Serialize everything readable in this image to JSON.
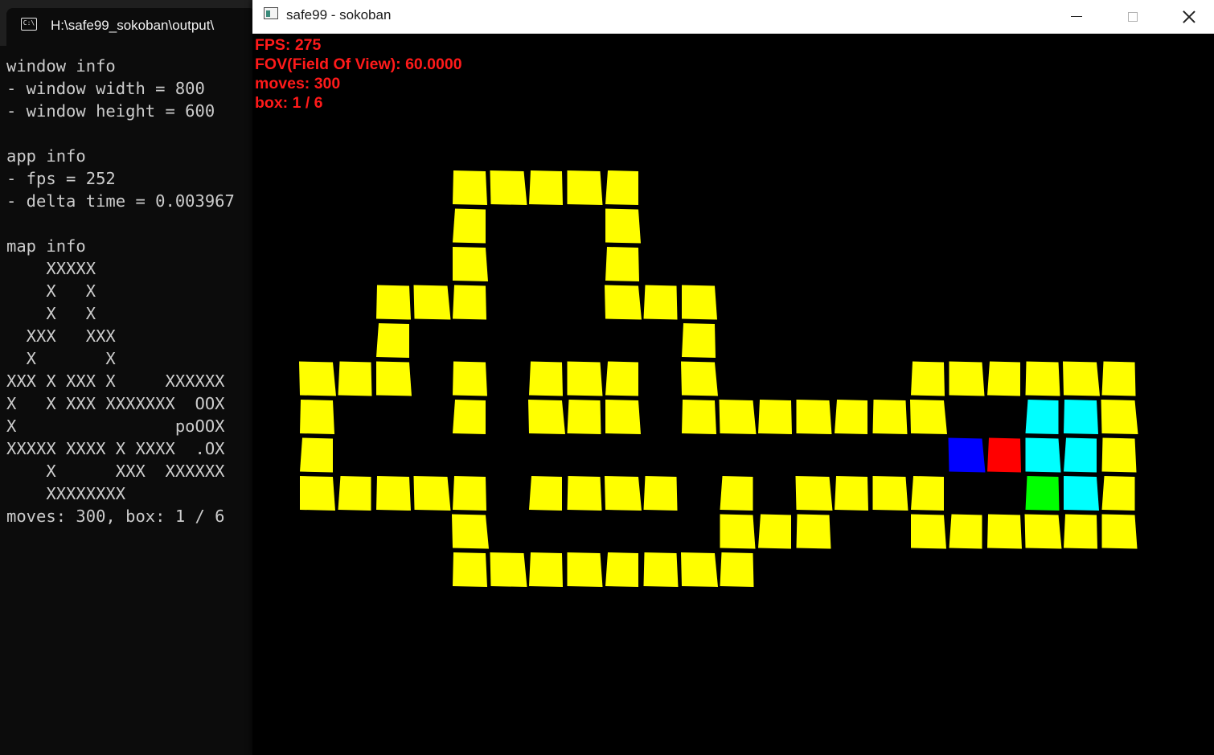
{
  "console": {
    "tab_title": "H:\\safe99_sokoban\\output\\",
    "tab_icon": "terminal-icon",
    "text": "window info\n- window width = 800\n- window height = 600\n\napp info\n- fps = 252\n- delta time = 0.003967\n\nmap info\n    XXXXX\n    X   X\n    X   X\n  XXX   XXX\n  X       X\nXXX X XXX X     XXXXXX\nX   X XXX XXXXXXX  OOX\nX                poOOX\nXXXXX XXXX X XXXX  .OX\n    X      XXX  XXXXXX\n    XXXXXXXX\nmoves: 300, box: 1 / 6"
  },
  "window": {
    "title": "safe99 - sokoban",
    "icon": "app-window-icon",
    "buttons": {
      "minimize": "minimize-icon",
      "maximize": "maximize-icon",
      "close": "close-icon"
    }
  },
  "hud": {
    "fps": "FPS: 275",
    "fov": "FOV(Field Of View): 60.0000",
    "moves": "moves: 300",
    "box": "box: 1 / 6"
  },
  "scene": {
    "colors": {
      "wall": "#ffff00",
      "goal": "#00ffff",
      "player": "#0000ff",
      "red_tile": "#ff0000",
      "green_tile": "#00ff00",
      "background": "#000000"
    },
    "map_rows": [
      "    XXXXX",
      "    X   X",
      "    X   X",
      "  XXX   XXX",
      "  X       X",
      "XXX X XXX X     XXXXXX",
      "X   X XXX XXXXXXX  OOX",
      "X                poOOX",
      "XXXXX XXXX X XXXX  .OX",
      "    X      XXX  XXXXXX",
      "    XXXXXXXX"
    ]
  }
}
